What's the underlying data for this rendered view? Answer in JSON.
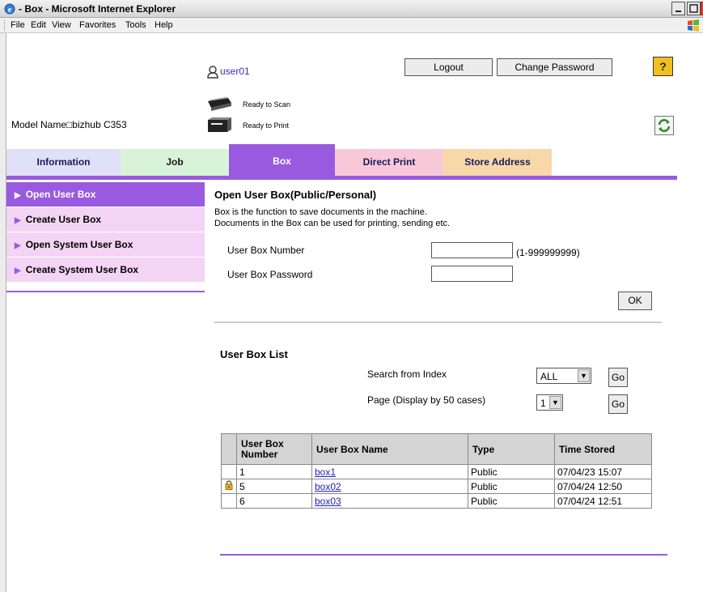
{
  "window": {
    "title": "- Box - Microsoft Internet Explorer"
  },
  "menubar": [
    "File",
    "Edit",
    "View",
    "Favorites",
    "Tools",
    "Help"
  ],
  "header": {
    "username": "user01",
    "logout": "Logout",
    "change_password": "Change Password",
    "help": "?",
    "model_name": "Model Name□bizhub C353",
    "scan_status": "Ready to Scan",
    "print_status": "Ready to Print"
  },
  "tabs": [
    "Information",
    "Job",
    "Box",
    "Direct Print",
    "Store Address"
  ],
  "active_tab": "Box",
  "sidebar": {
    "items": [
      "Open User Box",
      "Create User Box",
      "Open System User Box",
      "Create System User Box"
    ],
    "active_index": 0
  },
  "open_box": {
    "title": "Open User Box(Public/Personal)",
    "desc1": "Box is the function to save documents in the machine.",
    "desc2": "Documents in the Box can be used for printing, sending etc.",
    "number_label": "User Box Number",
    "number_value": "",
    "range": "(1-999999999)",
    "password_label": "User Box Password",
    "password_value": "",
    "ok": "OK"
  },
  "box_list": {
    "title": "User Box List",
    "search_label": "Search from Index",
    "search_value": "ALL",
    "page_label": "Page (Display by 50 cases)",
    "page_value": "1",
    "go": "Go",
    "columns": [
      "User Box Number",
      "User Box Name",
      "Type",
      "Time Stored"
    ],
    "rows": [
      {
        "locked": false,
        "number": "1",
        "name": "box1",
        "type": "Public",
        "time": "07/04/23 15:07"
      },
      {
        "locked": true,
        "number": "5",
        "name": "box02",
        "type": "Public",
        "time": "07/04/24 12:50"
      },
      {
        "locked": false,
        "number": "6",
        "name": "box03",
        "type": "Public",
        "time": "07/04/24 12:51"
      }
    ]
  },
  "colors": {
    "accent": "#9a5ae0",
    "sidebar_bg": "#f4d4f4",
    "link": "#2222bb"
  }
}
